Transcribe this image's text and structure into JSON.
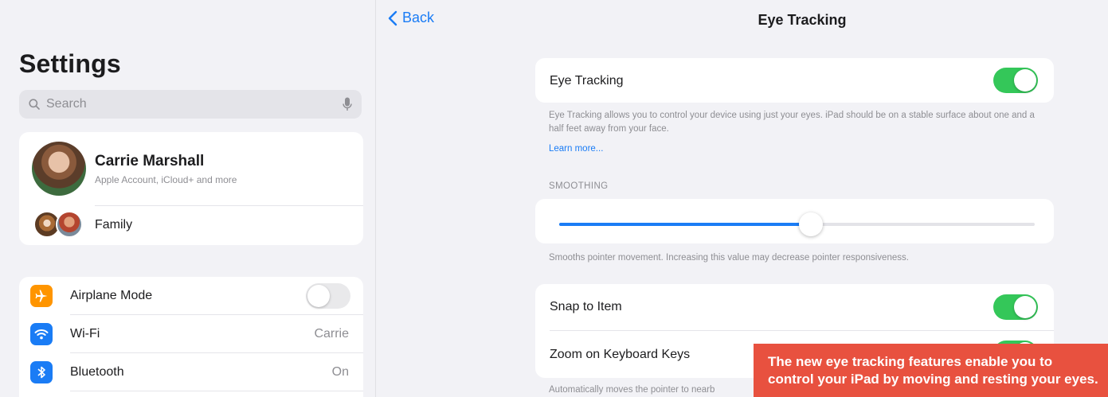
{
  "sidebar": {
    "title": "Settings",
    "search": {
      "placeholder": "Search"
    },
    "account": {
      "name": "Carrie Marshall",
      "subtitle": "Apple Account, iCloud+ and more",
      "family_label": "Family"
    },
    "items": [
      {
        "label": "Airplane Mode",
        "icon": "airplane-icon",
        "icon_color": "#ff9500",
        "toggle": false
      },
      {
        "label": "Wi-Fi",
        "icon": "wifi-icon",
        "icon_color": "#1a7cf5",
        "value": "Carrie"
      },
      {
        "label": "Bluetooth",
        "icon": "bluetooth-icon",
        "icon_color": "#1a7cf5",
        "value": "On"
      }
    ]
  },
  "detail": {
    "back_label": "Back",
    "title": "Eye Tracking",
    "eye_tracking": {
      "label": "Eye Tracking",
      "enabled": true,
      "description": "Eye Tracking allows you to control your device using just your eyes. iPad should be on a stable surface about one and a half feet away from your face.",
      "learn_more": "Learn more..."
    },
    "smoothing": {
      "header": "SMOOTHING",
      "value": 0.53,
      "footnote": "Smooths pointer movement. Increasing this value may decrease pointer responsiveness."
    },
    "options": [
      {
        "label": "Snap to Item",
        "enabled": true
      },
      {
        "label": "Zoom on Keyboard Keys",
        "enabled": true
      }
    ],
    "options_footnote": "Automatically moves the pointer to nearb"
  },
  "caption": {
    "text": "The new eye tracking features enable you to control your iPad by moving and resting your eyes."
  },
  "colors": {
    "accent": "#1a7cf5",
    "toggle_on": "#34c759",
    "caption_bg": "#e8513f"
  }
}
